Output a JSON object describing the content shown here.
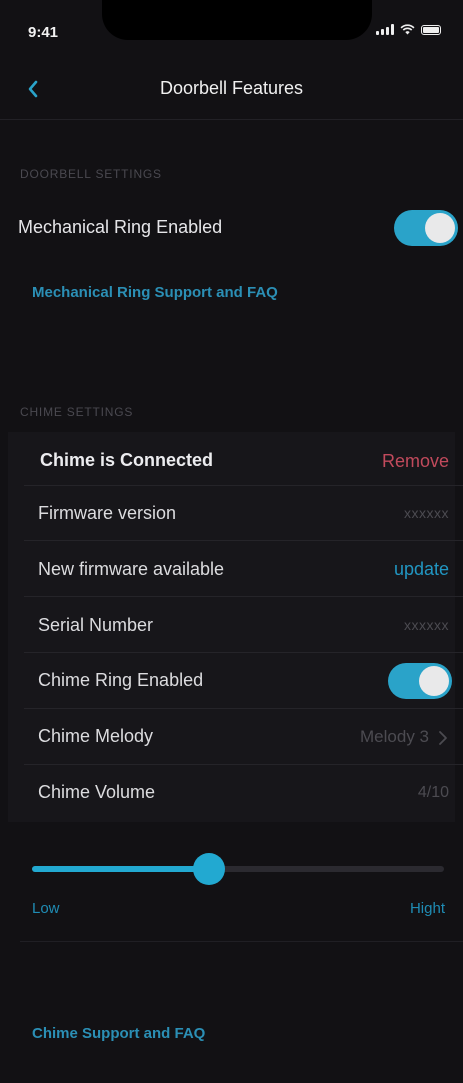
{
  "status_bar": {
    "time": "9:41"
  },
  "nav": {
    "title": "Doorbell Features"
  },
  "doorbell_settings": {
    "header": "DOORBELL SETTINGS",
    "mechanical_ring_label": "Mechanical Ring Enabled",
    "mechanical_ring_on": true,
    "support_link": "Mechanical Ring Support and FAQ"
  },
  "chime_settings": {
    "header": "CHIME SETTINGS",
    "connected_label": "Chime is Connected",
    "remove_label": "Remove",
    "rows": [
      {
        "label": "Firmware version",
        "value": "xxxxxx"
      },
      {
        "label": "New firmware available",
        "value": "update"
      },
      {
        "label": "Serial Number",
        "value": "xxxxxx"
      },
      {
        "label": "Chime Ring Enabled",
        "toggle_on": true
      },
      {
        "label": "Chime Melody",
        "value": "Melody 3"
      },
      {
        "label": "Chime Volume",
        "value": "4/10"
      }
    ],
    "volume_level": 0.43,
    "slider_low_label": "Low",
    "slider_high_label": "Hight",
    "support_link": "Chime Support and FAQ"
  },
  "colors": {
    "accent": "#2aa3c9",
    "link": "#2b8fb5",
    "remove": "#c14a5c",
    "background": "#121114"
  },
  "icons": [
    "back-chevron-icon",
    "signal-icon",
    "wifi-icon",
    "battery-icon",
    "chevron-right-icon"
  ]
}
